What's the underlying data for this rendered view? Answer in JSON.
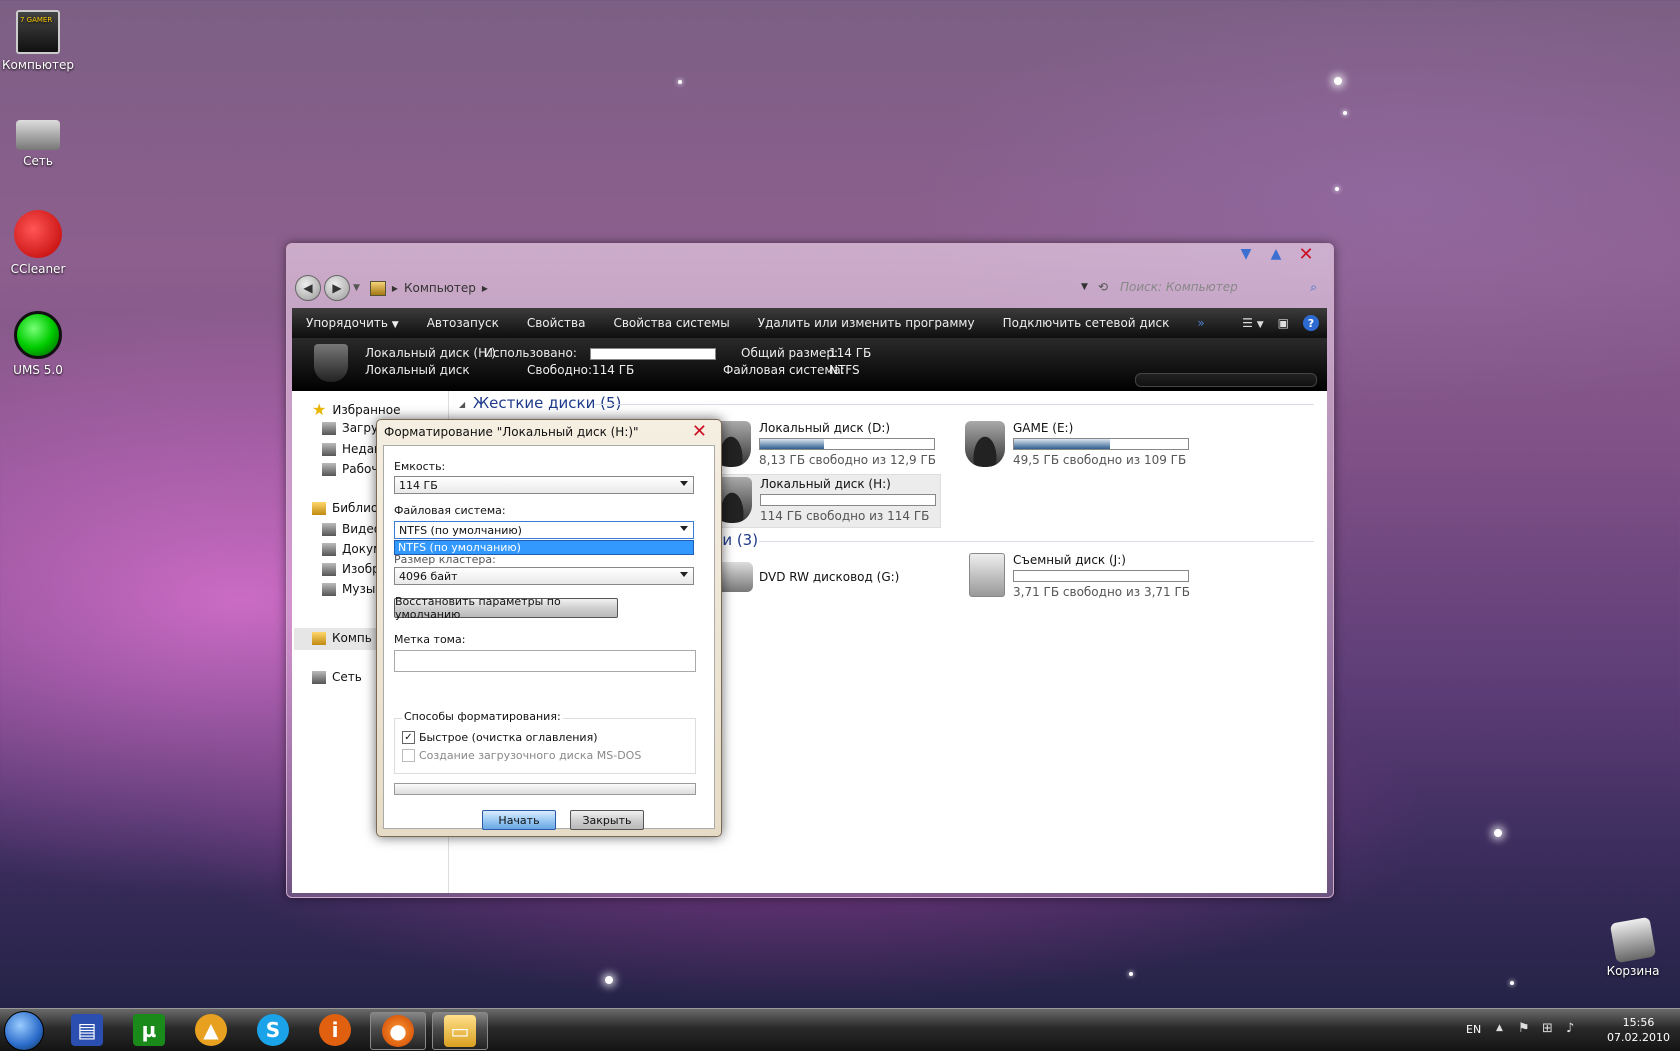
{
  "desktop": {
    "icons": [
      {
        "label": "Компьютер"
      },
      {
        "label": "Сеть"
      },
      {
        "label": "CCleaner"
      },
      {
        "label": "UMS 5.0"
      },
      {
        "label": "Корзина"
      }
    ]
  },
  "explorer": {
    "breadcrumb": "Компьютер",
    "search_placeholder": "Поиск: Компьютер",
    "toolbar": [
      "Упорядочить",
      "Автозапуск",
      "Свойства",
      "Свойства системы",
      "Удалить или изменить программу",
      "Подключить сетевой диск"
    ],
    "toolbar_more": "»",
    "details": {
      "name": "Локальный диск (H:)",
      "type": "Локальный диск",
      "used_label": "Использовано:",
      "free_label": "Свободно:",
      "free_value": "114 ГБ",
      "total_label": "Общий размер:",
      "total_value": "114 ГБ",
      "fs_label": "Файловая система:",
      "fs_value": "NTFS"
    },
    "nav": {
      "favorites": "Избранное",
      "fav_items": [
        "Загру",
        "Недав",
        "Рабоч"
      ],
      "libraries": "Библио",
      "lib_items": [
        "Видео",
        "Докум",
        "Изобр",
        "Музы"
      ],
      "computer": "Компь",
      "network": "Сеть"
    },
    "groups": {
      "hard_disks": "Жесткие диски (5)",
      "removable": "ми (3)"
    },
    "drives": [
      {
        "name": "Локальный диск (D:)",
        "free": "8,13 ГБ свободно из 12,9 ГБ",
        "used_fraction": 0.37
      },
      {
        "name": "GAME (E:)",
        "free": "49,5 ГБ свободно из 109 ГБ",
        "used_fraction": 0.55
      },
      {
        "name": "Локальный диск (H:)",
        "free": "114 ГБ свободно из 114 ГБ",
        "used_fraction": 0.0
      },
      {
        "name": "DVD RW дисковод (G:)"
      },
      {
        "name": "Съемный диск (J:)",
        "free": "3,71 ГБ свободно из 3,71 ГБ",
        "used_fraction": 0.0
      }
    ]
  },
  "format_dialog": {
    "title": "Форматирование \"Локальный диск (H:)\"",
    "capacity_label": "Емкость:",
    "capacity_value": "114 ГБ",
    "fs_label": "Файловая система:",
    "fs_value": "NTFS (по умолчанию)",
    "fs_option": "NTFS (по умолчанию)",
    "cluster_label": "Размер кластера:",
    "cluster_value": "4096 байт",
    "restore_button": "Восстановить параметры по умолчанию",
    "volume_label": "Метка тома:",
    "volume_value": "",
    "methods_label": "Способы форматирования:",
    "quick_label": "Быстрое (очистка оглавления)",
    "quick_checked": true,
    "msdos_label": "Создание загрузочного диска MS-DOS",
    "start_button": "Начать",
    "close_button": "Закрыть"
  },
  "taskbar": {
    "lang": "EN",
    "time": "15:56",
    "date": "07.02.2010"
  }
}
